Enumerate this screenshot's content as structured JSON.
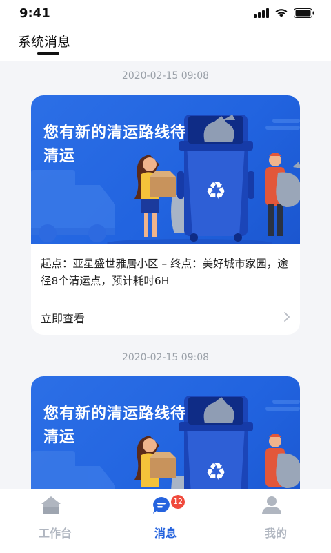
{
  "status_bar": {
    "time": "9:41"
  },
  "header": {
    "title": "系统消息"
  },
  "messages": [
    {
      "timestamp": "2020-02-15 09:08",
      "banner_title": "您有新的清运路线待清运",
      "description": "起点：亚星盛世雅居小区 – 终点：美好城市家园，途径8个清运点，预计耗时6H",
      "action_label": "立即查看"
    },
    {
      "timestamp": "2020-02-15 09:08",
      "banner_title": "您有新的清运路线待清运"
    }
  ],
  "tabbar": {
    "items": [
      {
        "label": "工作台",
        "icon": "home-icon",
        "active": false
      },
      {
        "label": "消息",
        "icon": "message-icon",
        "active": true,
        "badge": "12"
      },
      {
        "label": "我的",
        "icon": "user-icon",
        "active": false
      }
    ]
  },
  "colors": {
    "accent": "#2563de",
    "inactive": "#b0b6c0",
    "badge": "#f04a3c"
  }
}
